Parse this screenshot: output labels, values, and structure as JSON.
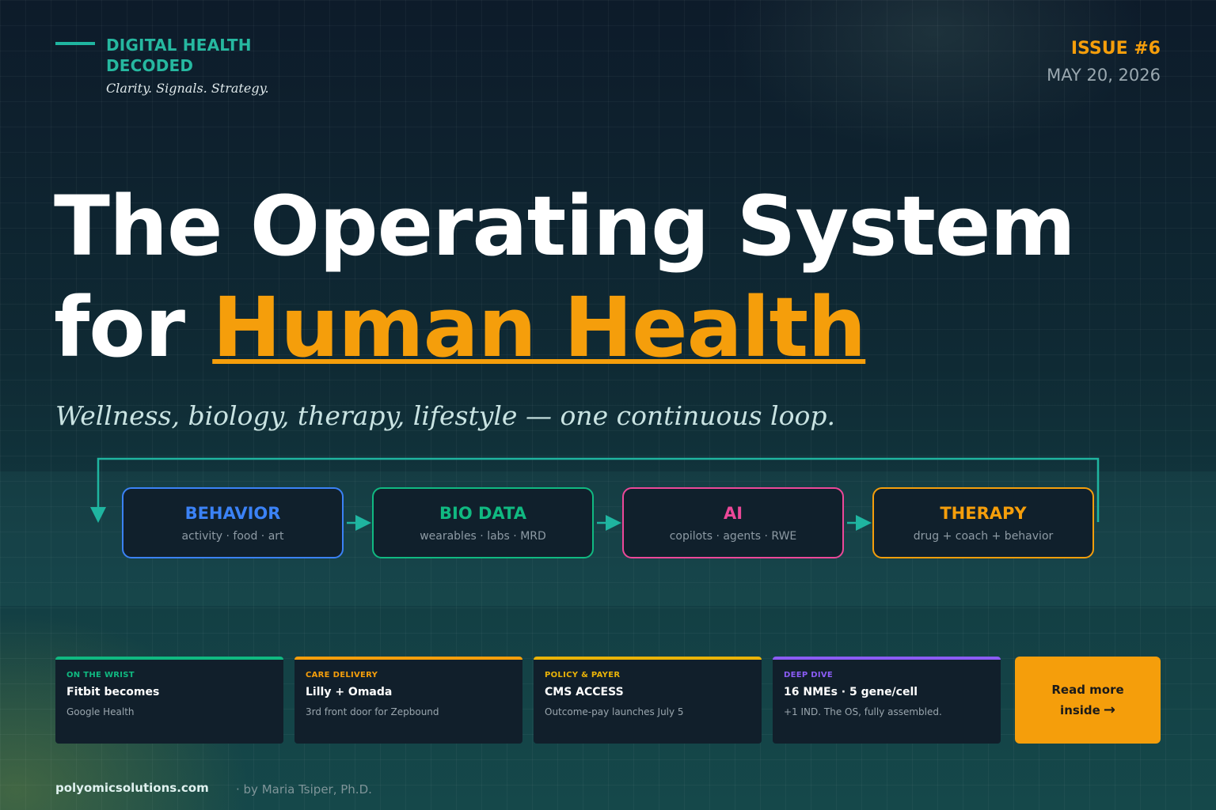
{
  "brand": {
    "title": "DIGITAL HEALTH DECODED",
    "tagline": "Clarity. Signals. Strategy."
  },
  "issue": {
    "number": "ISSUE #6",
    "date": "MAY 20, 2026"
  },
  "headline": {
    "line1": "The Operating System",
    "line2_prefix": "for",
    "line2_accent": "Human Health"
  },
  "subtitle": "Wellness, biology, therapy, lifestyle  —  one continuous loop.",
  "loop": {
    "stages": [
      {
        "title": "BEHAVIOR",
        "subtitle": "activity · food · art",
        "color": "#3b82f6"
      },
      {
        "title": "BIO DATA",
        "subtitle": "wearables · labs · MRD",
        "color": "#10b981"
      },
      {
        "title": "AI",
        "subtitle": "copilots · agents · RWE",
        "color": "#ec4899"
      },
      {
        "title": "THERAPY",
        "subtitle": "drug + coach + behavior",
        "color": "#f59e0b"
      }
    ],
    "connector_color": "#1fb5a0"
  },
  "cards": [
    {
      "tag": "ON THE WRIST",
      "title": "Fitbit becomes",
      "desc": "Google Health",
      "color": "#10b981"
    },
    {
      "tag": "CARE DELIVERY",
      "title": "Lilly + Omada",
      "desc": "3rd front door for Zepbound",
      "color": "#f59e0b"
    },
    {
      "tag": "POLICY & PAYER",
      "title": "CMS ACCESS",
      "desc": "Outcome-pay launches July 5",
      "color": "#eab308"
    },
    {
      "tag": "DEEP DIVE",
      "title": "16 NMEs · 5 gene/cell",
      "desc": "+1 IND. The OS, fully assembled.",
      "color": "#8b5cf6"
    }
  ],
  "cta": {
    "line1": "Read more",
    "line2": "inside",
    "arrow": "→"
  },
  "footer": {
    "site": "polyomicsolutions.com",
    "author": "·    by Maria Tsiper, Ph.D."
  },
  "colors": {
    "accent": "#f59e0b",
    "brand": "#26b8a0",
    "background": "#0f2a34"
  }
}
